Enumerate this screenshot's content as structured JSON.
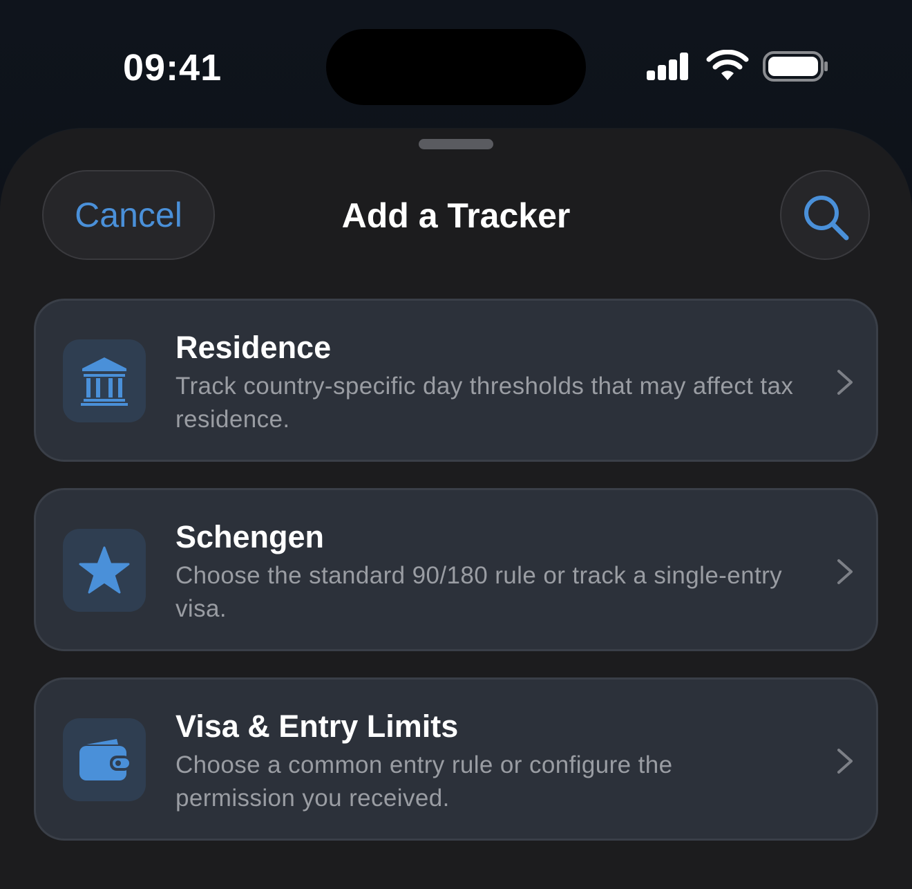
{
  "status_bar": {
    "time": "09:41",
    "icons": [
      "cellular-signal-icon",
      "wifi-icon",
      "battery-icon"
    ]
  },
  "sheet": {
    "cancel_label": "Cancel",
    "title": "Add a Tracker",
    "search_icon": "search-icon"
  },
  "options": [
    {
      "title": "Residence",
      "description": "Track country-specific day thresholds that may affect tax residence.",
      "icon": "building-columns-icon"
    },
    {
      "title": "Schengen",
      "description": "Choose the standard 90/180 rule or track a single-entry visa.",
      "icon": "star-icon"
    },
    {
      "title": "Visa & Entry Limits",
      "description": "Choose a common entry rule or configure the permission you received.",
      "icon": "wallet-icon"
    }
  ],
  "colors": {
    "accent": "#4a90d9",
    "sheet_background": "#1c1c1e",
    "card_background": "#2c313a",
    "icon_tile": "#2f3e51",
    "secondary_text": "#9a9da3"
  }
}
